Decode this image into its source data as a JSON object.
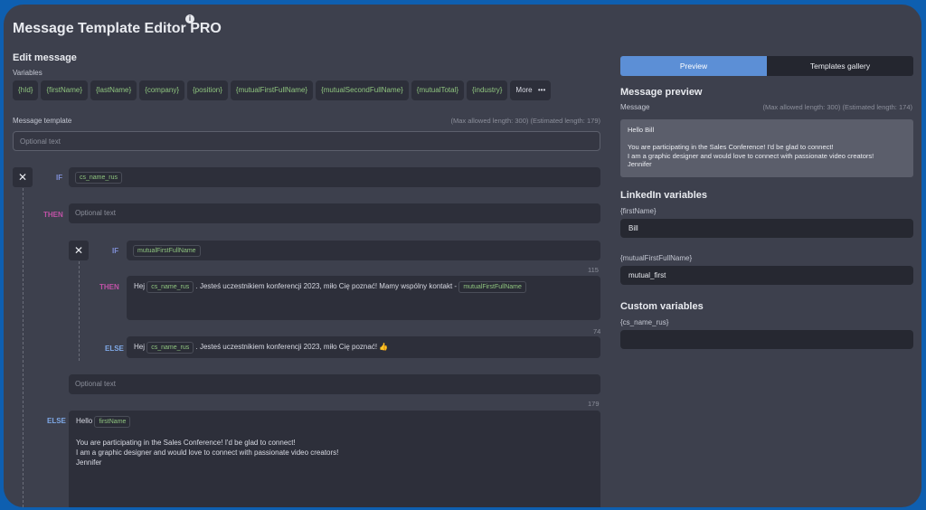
{
  "app": {
    "title": "Message Template Editor PRO",
    "info_icon": "i"
  },
  "edit": {
    "title": "Edit message",
    "variables_label": "Variables",
    "variables": [
      "{hId}",
      "{firstName}",
      "{lastName}",
      "{company}",
      "{position}",
      "{mutualFirstFullName}",
      "{mutualSecondFullName}",
      "{mutualTotal}",
      "{industry}"
    ],
    "more_label": "More",
    "more_icon": "•••",
    "template_label": "Message template",
    "template_lengths": "(Max allowed length: 300) (Estimated length: 179)",
    "template_placeholder": "Optional text"
  },
  "condition": {
    "close_icon": "✕",
    "if_kw": "IF",
    "if_var": "cs_name_rus",
    "then_kw": "THEN",
    "then_placeholder": "Optional text",
    "inner": {
      "close_icon": "✕",
      "if_kw": "IF",
      "if_var": "mutualFirstFullName",
      "then_count": "115",
      "then_kw": "THEN",
      "then_prefix": "Hej",
      "then_var1": "cs_name_rus",
      "then_mid": ". Jesteś uczestnikiem konferencji 2023, miło Cię poznać! Mamy wspólny kontakt -",
      "then_var2": "mutualFirstFullName",
      "else_count": "74",
      "else_kw": "ELSE",
      "else_prefix": "Hej",
      "else_var": "cs_name_rus",
      "else_text": ". Jesteś uczestnikiem konferencji 2023, miło Cię poznać! 👍"
    },
    "after_placeholder": "Optional text",
    "else_count": "179",
    "else_kw": "ELSE",
    "else_hello": "Hello",
    "else_var": "firstName",
    "else_line1": "You are participating in the Sales Conference! I'd be glad to connect!",
    "else_line2": "I am a graphic designer and would love to connect with passionate video creators!",
    "else_line3": "Jennifer"
  },
  "tabs": {
    "preview": "Preview",
    "gallery": "Templates gallery"
  },
  "preview": {
    "title": "Message preview",
    "message_label": "Message",
    "lengths": "(Max allowed length: 300) (Estimated length: 174)",
    "line1": "Hello Bill",
    "line2": "You are participating in the Sales Conference! I'd be glad to connect!",
    "line3": "I am a graphic designer and would love to connect with passionate video creators!",
    "line4": "Jennifer"
  },
  "linkedin": {
    "title": "LinkedIn variables",
    "first_label": "{firstName}",
    "first_value": "Bill",
    "mutual_label": "{mutualFirstFullName}",
    "mutual_value": "mutual_first"
  },
  "custom": {
    "title": "Custom variables",
    "cs_label": "{cs_name_rus}",
    "cs_value": ""
  }
}
